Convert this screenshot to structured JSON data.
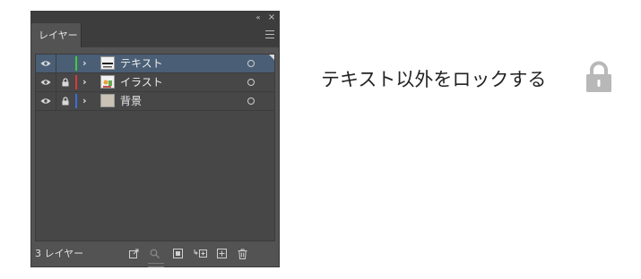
{
  "panel": {
    "collapse_glyph": "«",
    "close_glyph": "×",
    "tab_label": "レイヤー",
    "layers": [
      {
        "name": "テキスト",
        "color": "#3ccf3c",
        "visible": true,
        "locked": false,
        "selected": true,
        "thumb": "text-thumbnail"
      },
      {
        "name": "イラスト",
        "color": "#d93a3a",
        "visible": true,
        "locked": true,
        "selected": false,
        "thumb": "illustration-thumbnail"
      },
      {
        "name": "背景",
        "color": "#3b6fd9",
        "visible": true,
        "locked": true,
        "selected": false,
        "thumb": "plain-thumbnail"
      }
    ],
    "layer_count": "3 レイヤー"
  },
  "caption": {
    "text": "テキスト以外をロックする"
  },
  "colors": {
    "panel_bg": "#535353",
    "list_bg": "#474747",
    "selected_row": "#4a5f76",
    "lock_icon": "#b8b8b8"
  }
}
